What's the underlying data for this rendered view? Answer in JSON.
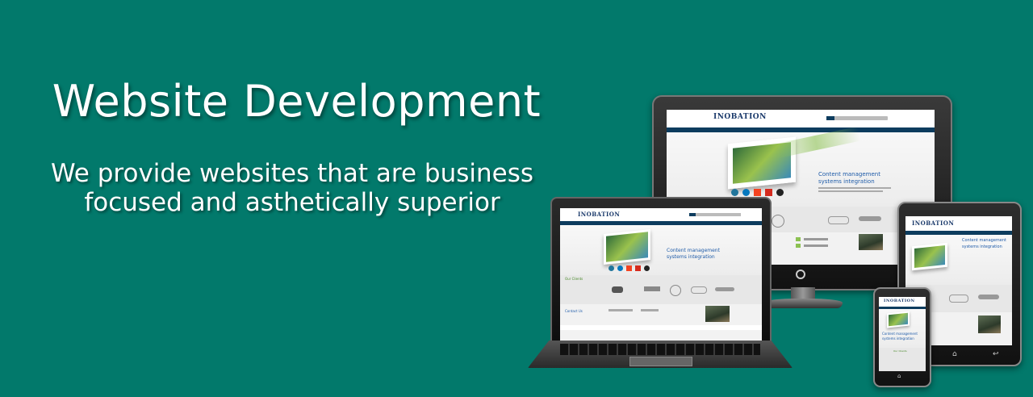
{
  "hero": {
    "title": "Website Development",
    "subtitle_line1": "We provide websites that are business",
    "subtitle_line2": "focused and asthetically superior"
  },
  "mockup_site": {
    "logo": "INOBATION",
    "headline_1": "Content management",
    "headline_2": "systems integration",
    "clients_heading": "Our Clients",
    "contact_heading": "Contact Us"
  },
  "colors": {
    "background": "#02796b",
    "site_navy": "#0d3c5e",
    "site_blue": "#1d5aa8",
    "site_green": "#4a8a2a"
  },
  "icons": [
    "home-icon",
    "back-icon",
    "power-icon"
  ]
}
